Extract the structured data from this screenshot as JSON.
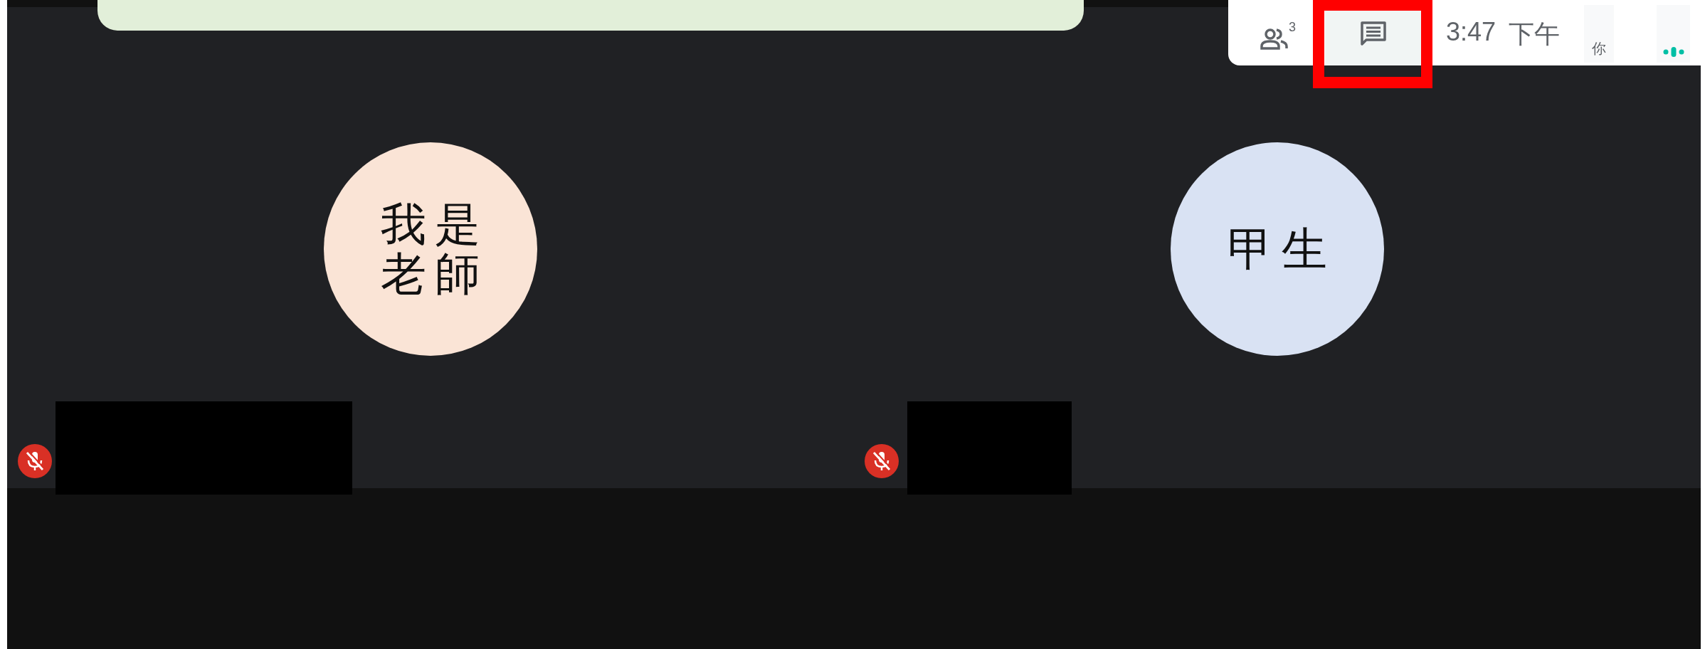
{
  "toolbar": {
    "participant_count": "3",
    "chat": {
      "selected": true
    },
    "time": "3:47",
    "period": "下午",
    "self_label": "你"
  },
  "tiles": [
    {
      "name": "我是老師",
      "color": "#fae4d6",
      "muted": true
    },
    {
      "name": "甲生",
      "color": "#d9e2f3",
      "muted": true
    }
  ]
}
